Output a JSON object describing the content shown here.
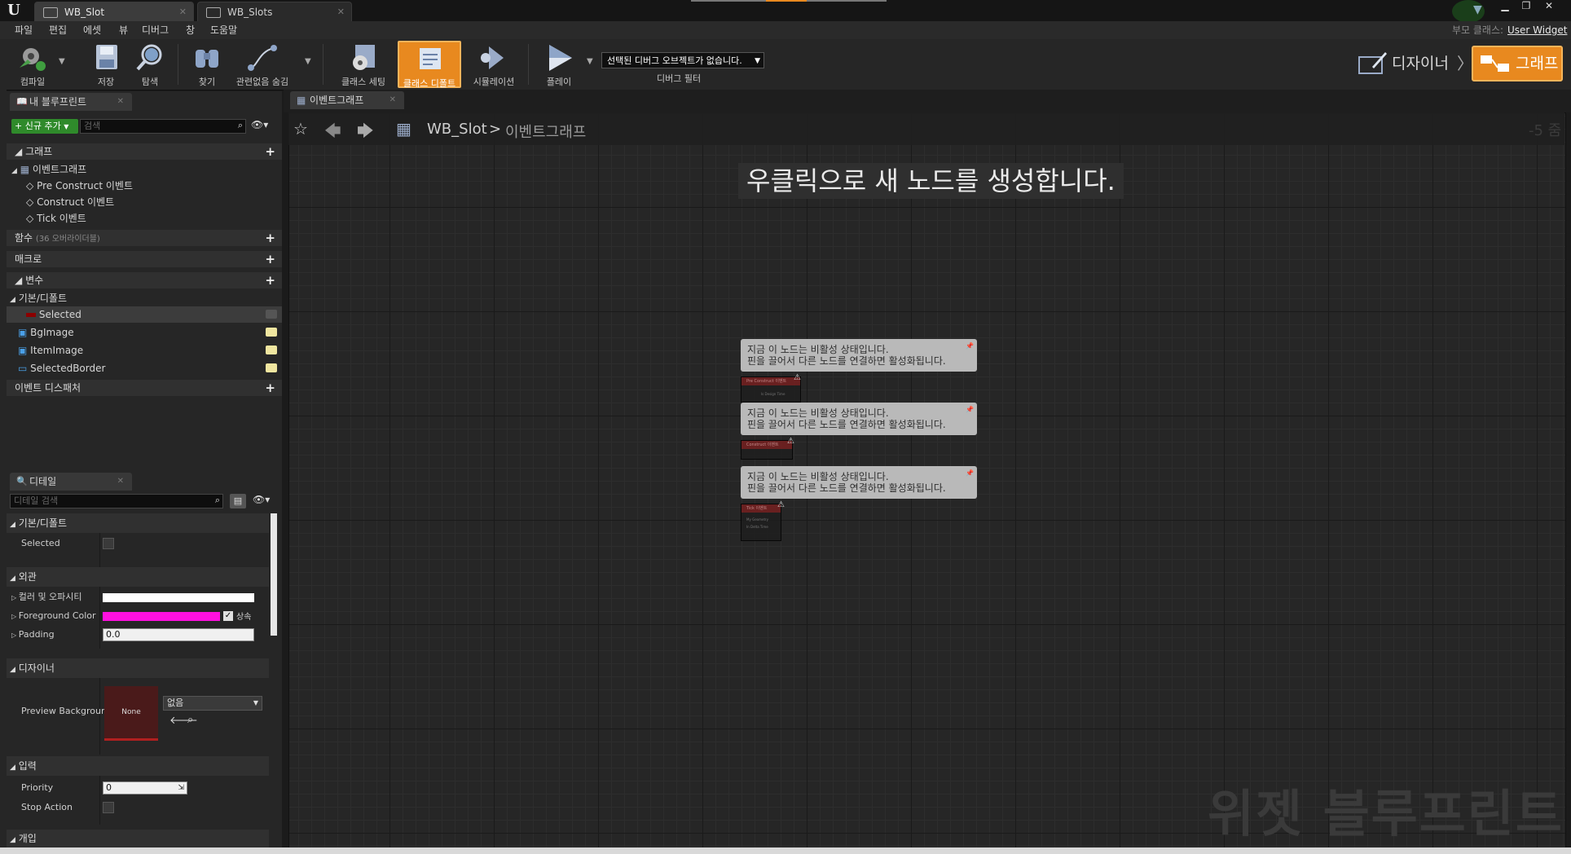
{
  "tabs": [
    {
      "label": "WB_Slot",
      "icon": "widget-blueprint-icon",
      "active": true
    },
    {
      "label": "WB_Slots",
      "icon": "widget-blueprint-icon",
      "active": false
    }
  ],
  "menu": [
    "파일",
    "편집",
    "에셋",
    "뷰",
    "디버그",
    "창",
    "도움말"
  ],
  "parent_class": {
    "label": "부모 클래스:",
    "value": "User Widget"
  },
  "toolbar": {
    "compile": "컴파일",
    "save": "저장",
    "browse": "탐색",
    "find": "찾기",
    "hide_unrelated": "관련없음 숨김",
    "class_settings": "클래스 세팅",
    "class_defaults": "클래스 디폴트",
    "simulation": "시뮬레이션",
    "play": "플레이",
    "debug_select": "선택된 디버그 오브젝트가 없습니다.",
    "debug_filter": "디버그 필터",
    "designer": "디자이너",
    "graph": "그래프"
  },
  "my_blueprint": {
    "tab": "내 블루프린트",
    "add_new": "+ 신규 추가",
    "search_placeholder": "검색",
    "graphs_header": "그래프",
    "event_graph": "이벤트그래프",
    "events": [
      "Pre Construct 이벤트",
      "Construct 이벤트",
      "Tick 이벤트"
    ],
    "functions": "함수",
    "functions_note": "(36 오버라이더블)",
    "macros": "매크로",
    "variables": "변수",
    "defaults_category": "기본/디폴트",
    "variable_items": [
      "Selected",
      "BgImage",
      "ItemImage",
      "SelectedBorder"
    ],
    "event_dispatchers": "이벤트 디스패처"
  },
  "details": {
    "tab": "디테일",
    "search_placeholder": "디테일 검색",
    "cat_defaults": "기본/디폴트",
    "selected_label": "Selected",
    "cat_appearance": "외관",
    "color_opacity": "컬러 및 오파시티",
    "foreground_color": "Foreground Color",
    "inherit": "상속",
    "padding": "Padding",
    "padding_value": "0.0",
    "cat_designer": "디자이너",
    "preview_background": "Preview Backgroun",
    "preview_none": "None",
    "preview_select": "없음",
    "cat_input": "입력",
    "priority": "Priority",
    "priority_value": "0",
    "stop_action": "Stop Action",
    "cat_interaction": "개입"
  },
  "graph": {
    "tab": "이벤트그래프",
    "breadcrumb_root": "WB_Slot",
    "breadcrumb_sep": ">",
    "breadcrumb_current": "이벤트그래프",
    "zoom": "-5 줌",
    "hint": "우클릭으로 새 노드를 생성합니다.",
    "comment_line1": "지금 이 노드는 비활성 상태입니다.",
    "comment_line2": "핀을 끌어서 다른 노드를 연결하면 활성화됩니다.",
    "nodes": [
      "Pre Construct 이벤트",
      "Construct 이벤트",
      "Tick 이벤트"
    ],
    "node_pins": {
      "pre_construct": "Is Design Time",
      "tick_geometry": "My Geometry",
      "tick_delta": "In Delta Time"
    },
    "watermark": "위젯 블루프린트"
  },
  "colors": {
    "accent": "#e8891f",
    "add_green": "#2f8a2b",
    "foreground": "#ff10e0",
    "event_node": "#7a1f1f"
  }
}
